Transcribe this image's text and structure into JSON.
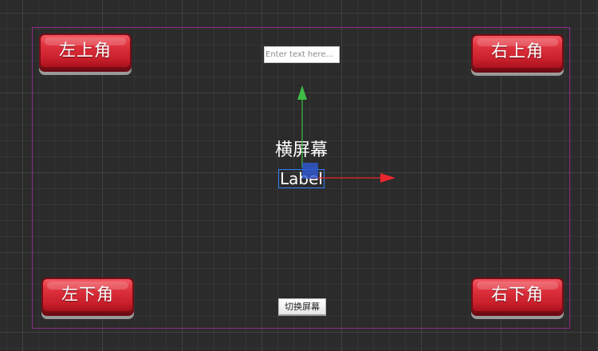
{
  "scene": {
    "top_left_button": "左上角",
    "top_right_button": "右上角",
    "bottom_left_button": "左下角",
    "bottom_right_button": "右下角",
    "text_input": {
      "value": "",
      "placeholder": "Enter text here..."
    },
    "title_label": "横屏幕",
    "label_node": "Label",
    "switch_button": "切换屏幕"
  },
  "gizmo": {
    "icons": [
      "move-gizmo-icon"
    ],
    "x_axis_color": "#e8262b",
    "y_axis_color": "#3fbd45",
    "center_color": "#2f5bd8"
  },
  "colors": {
    "button_red": "#d62a35",
    "frame_border": "#8a2d8a",
    "selection": "#2f7ff5"
  }
}
